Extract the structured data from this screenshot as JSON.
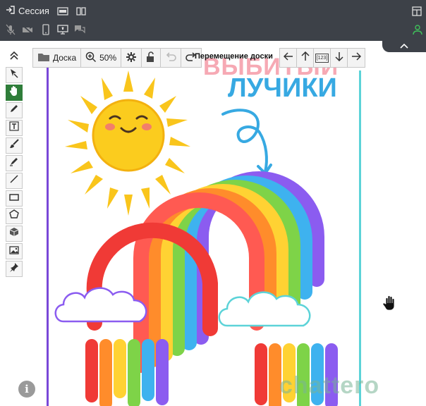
{
  "session": {
    "label": "Сессия"
  },
  "board_toolbar": {
    "board_label": "Доска",
    "zoom": "50%"
  },
  "navigation": {
    "label": "Перемещение доски",
    "fit_label": "[123]"
  },
  "content": {
    "title_top": "ВЫБИТЫЙ",
    "title_bottom": "ЛУЧИКИ"
  },
  "watermark": {
    "text": "chattero"
  },
  "info": {
    "symbol": "i"
  },
  "colors": {
    "topbar": "#3d4148",
    "active_tool": "#2f7d3a",
    "title_blue": "#37a9e2",
    "title_pink": "#f6a9b4",
    "sun": "#f9c51c",
    "rainbow": [
      "#f03a36",
      "#ff8c2b",
      "#ffd233",
      "#7ed348",
      "#3eb2ef",
      "#8b5cf0"
    ]
  },
  "icons": {
    "topbar_row1": [
      "login-arrow-icon",
      "record-icon",
      "book-icon",
      "layout-icon"
    ],
    "topbar_row2": [
      "mic-off-icon",
      "camera-off-icon",
      "phone-icon",
      "screen-share-icon",
      "chat-icon",
      "user-icon"
    ],
    "tools": [
      "collapse-up-icon",
      "select-arrow-icon",
      "hand-icon",
      "pen-icon",
      "text-icon",
      "brush-icon",
      "marker-icon",
      "line-icon",
      "rectangle-icon",
      "polygon-icon",
      "cube-icon",
      "image-icon",
      "pin-icon"
    ]
  }
}
